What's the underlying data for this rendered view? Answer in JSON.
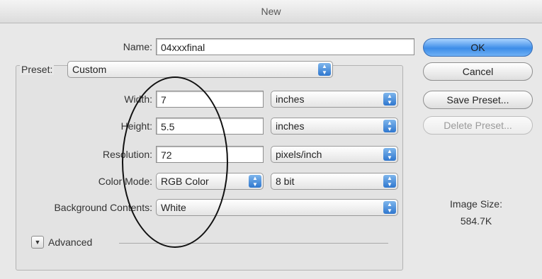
{
  "window": {
    "title": "New"
  },
  "form": {
    "name_label": "Name:",
    "name_value": "04xxxfinal",
    "preset_label": "Preset:",
    "preset_value": "Custom",
    "width_label": "Width:",
    "width_value": "7",
    "width_unit": "inches",
    "height_label": "Height:",
    "height_value": "5.5",
    "height_unit": "inches",
    "resolution_label": "Resolution:",
    "resolution_value": "72",
    "resolution_unit": "pixels/inch",
    "color_mode_label": "Color Mode:",
    "color_mode_value": "RGB Color",
    "bit_depth_value": "8 bit",
    "background_label": "Background Contents:",
    "background_value": "White",
    "advanced_label": "Advanced"
  },
  "buttons": {
    "ok": "OK",
    "cancel": "Cancel",
    "save_preset": "Save Preset...",
    "delete_preset": "Delete Preset..."
  },
  "info": {
    "image_size_label": "Image Size:",
    "image_size_value": "584.7K"
  },
  "annotation": {
    "shape": "hand-drawn ellipse",
    "color": "#111111"
  }
}
